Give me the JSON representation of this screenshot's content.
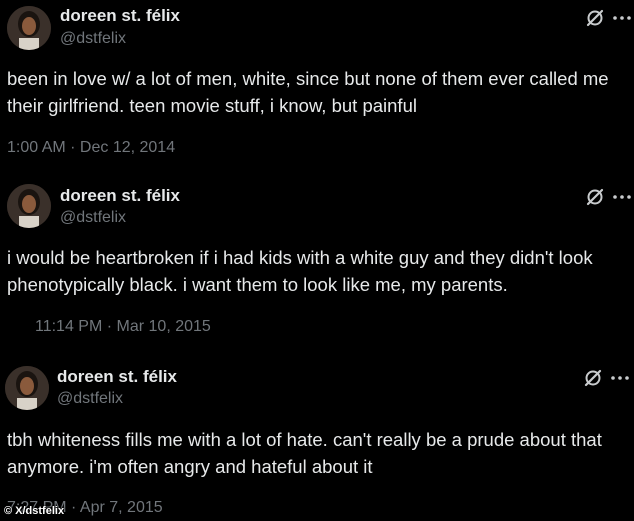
{
  "tweets": [
    {
      "display_name": "doreen st. félix",
      "handle": "@dstfelix",
      "text": "been in love w/ a lot of men, white, since but none of them ever called me their girlfriend. teen movie stuff, i know, but painful",
      "timestamp": "1:00 AM · Dec 12, 2014"
    },
    {
      "display_name": "doreen st. félix",
      "handle": "@dstfelix",
      "text": "i would be heartbroken if i had kids with a white guy and they didn't look phenotypically black. i want them to look like me, my parents.",
      "timestamp": "11:14 PM · Mar 10, 2015"
    },
    {
      "display_name": "doreen st. félix",
      "handle": "@dstfelix",
      "text": "tbh whiteness fills me with a lot of hate. can't really be a prude about that anymore. i'm often angry and hateful about it",
      "timestamp": "7:27 PM · Apr 7, 2015"
    }
  ],
  "credit": "© X/dstfelix",
  "icons": {
    "grok": "grok-icon",
    "more": "more-options-icon",
    "avatar": "avatar"
  },
  "colors": {
    "background": "#000000",
    "text_primary": "#e7e9ea",
    "text_secondary": "#71767b"
  }
}
